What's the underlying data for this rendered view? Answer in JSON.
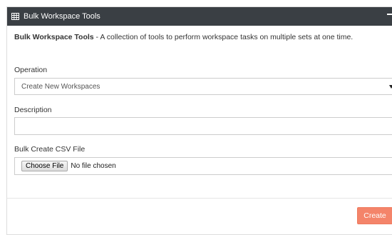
{
  "panel": {
    "title": "Bulk Workspace Tools",
    "header_icon": "grid-icon",
    "minimize_icon": "minimize-icon",
    "header_bg": "#3a3f44"
  },
  "intro": {
    "bold": "Bulk Workspace Tools",
    "text": " - A collection of tools to perform workspace tasks on multiple sets at one time."
  },
  "form": {
    "operation_label": "Operation",
    "operation_value": "Create New Workspaces",
    "description_label": "Description",
    "description_value": "",
    "csv_label": "Bulk Create CSV File",
    "choose_file_label": "Choose File",
    "file_status": "No file chosen"
  },
  "footer": {
    "create_label": "Create",
    "create_color": "#f4846a"
  }
}
